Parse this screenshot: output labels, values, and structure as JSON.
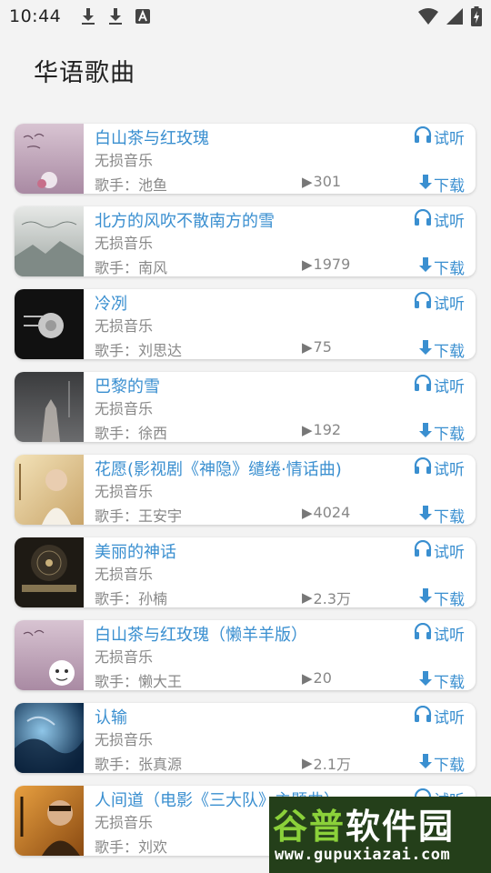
{
  "status_bar": {
    "time": "10:44",
    "left_icons": [
      "download-icon",
      "download-icon",
      "text-a-icon"
    ],
    "right_icons": [
      "wifi-icon",
      "signal-icon",
      "battery-charging-icon"
    ]
  },
  "page": {
    "title": "华语歌曲"
  },
  "colors": {
    "accent": "#3a8fd0",
    "muted": "#888888",
    "background": "#f3f3f3"
  },
  "labels": {
    "listen": "试听",
    "download": "下载",
    "listen_icon": "headphones-icon",
    "download_icon": "download-arrow-icon",
    "play_icon": "play-triangle-icon"
  },
  "songs": [
    {
      "title": "白山茶与红玫瑰",
      "quality": "无损音乐",
      "artist": "歌手：池鱼",
      "plays": "301",
      "cover_theme": "pink-floral"
    },
    {
      "title": "北方的风吹不散南方的雪",
      "quality": "无损音乐",
      "artist": "歌手：南风",
      "plays": "1979",
      "cover_theme": "grey-mist"
    },
    {
      "title": "冷冽",
      "quality": "无损音乐",
      "artist": "歌手：刘思达",
      "plays": "75",
      "cover_theme": "black-flower"
    },
    {
      "title": "巴黎的雪",
      "quality": "无损音乐",
      "artist": "歌手：徐西",
      "plays": "192",
      "cover_theme": "dark-fog"
    },
    {
      "title": "花愿(影视剧《神隐》缱绻·情话曲)",
      "quality": "无损音乐",
      "artist": "歌手：王安宇",
      "plays": "4024",
      "cover_theme": "golden-portrait"
    },
    {
      "title": "美丽的神话",
      "quality": "无损音乐",
      "artist": "歌手：孙楠",
      "plays": "2.3万",
      "cover_theme": "vinyl-dark"
    },
    {
      "title": "白山茶与红玫瑰（懒羊羊版）",
      "quality": "无损音乐",
      "artist": "歌手：懒大王",
      "plays": "20",
      "cover_theme": "pink-sheep"
    },
    {
      "title": "认输",
      "quality": "无损音乐",
      "artist": "歌手：张真源",
      "plays": "2.1万",
      "cover_theme": "blue-ocean"
    },
    {
      "title": "人间道（电影《三大队》主题曲）",
      "quality": "无损音乐",
      "artist": "歌手：刘欢",
      "plays": "",
      "cover_theme": "orange-portrait"
    }
  ],
  "watermark": {
    "top_prefix": "谷普",
    "top_rest": "软件园",
    "bottom": "www.gupuxiazai.com"
  }
}
